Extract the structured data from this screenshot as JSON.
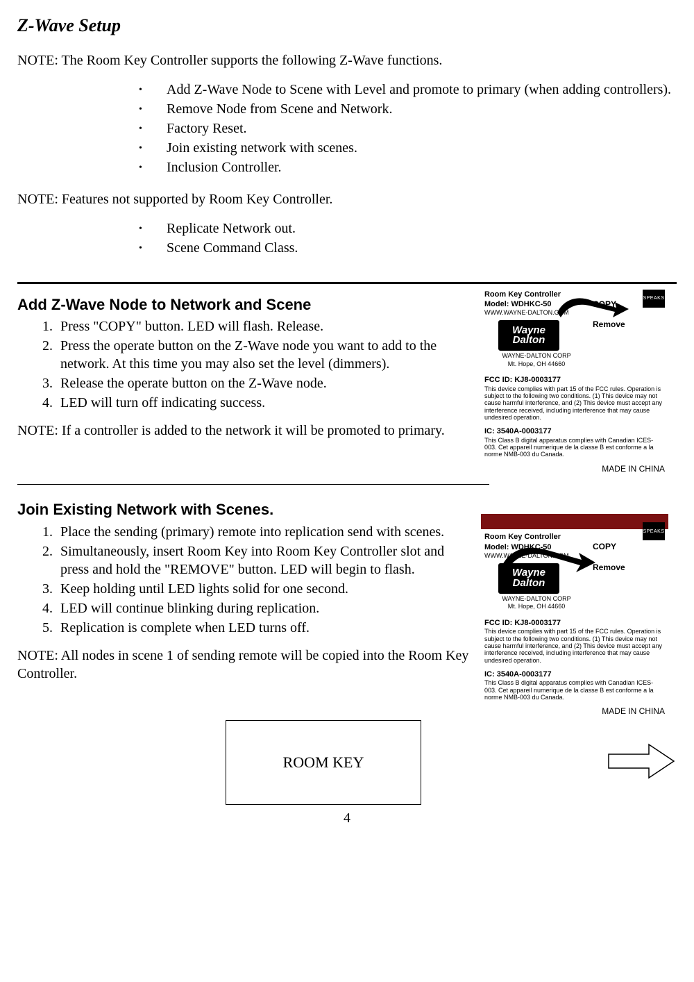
{
  "title": "Z-Wave Setup",
  "note1": "NOTE: The Room Key Controller supports the following Z-Wave functions.",
  "supported": [
    "Add Z-Wave Node to Scene with Level and promote to primary (when adding controllers).",
    "Remove Node from Scene and Network.",
    "Factory Reset.",
    "Join existing network with scenes.",
    "Inclusion Controller."
  ],
  "note2": "NOTE:  Features not supported by Room Key Controller.",
  "unsupported": [
    "Replicate Network out.",
    "Scene Command Class."
  ],
  "section1": {
    "heading": "Add Z-Wave Node to Network and Scene",
    "steps": [
      "Press \"COPY\" button.  LED will flash.  Release.",
      "Press the operate button on the Z-Wave node you want to add to the network.  At this time you may also set the level (dimmers).",
      "Release the operate button on the Z-Wave node.",
      "LED will turn off indicating success."
    ],
    "note": "NOTE: If a controller is added to the network it will be promoted to primary."
  },
  "section2": {
    "heading": "Join Existing Network with Scenes.",
    "steps": [
      "Place the sending (primary) remote into replication send with scenes.",
      "Simultaneously, insert Room Key into Room Key Controller slot and press and hold the \"REMOVE\" button.  LED will begin to flash.",
      "Keep holding until LED lights solid for one second.",
      "LED will continue blinking during replication.",
      "Replication is complete when LED turns off."
    ],
    "note": "NOTE:  All nodes in scene 1 of sending remote will be copied into the Room Key Controller."
  },
  "label": {
    "line1head": "Room Key Controller",
    "line2head": "Model:  WDHKC-50",
    "url": "WWW.WAYNE-DALTON.COM",
    "logo_top": "Wayne",
    "logo_bot": "Dalton",
    "corp": "WAYNE-DALTON CORP",
    "addr": "Mt. Hope, OH 44660",
    "copy_btn": "COPY",
    "remove_btn": "Remove",
    "fcc_hdr": "FCC ID: KJ8-0003177",
    "fcc_body": "This device complies with part 15 of the FCC rules. Operation is subject to the following two conditions. (1) This device may not cause harmful interference, and (2) This device must accept any interference received, including interference that may cause undesired operation.",
    "ic_hdr": "IC: 3540A-0003177",
    "ic_body": "This Class B digital apparatus complies with Canadian ICES-003. Cet appareil numerique de la classe B est conforme a la norme NMB-003 du Canada.",
    "made_in": "MADE IN CHINA",
    "badge": "SPEAKS"
  },
  "roomkey_box": "ROOM KEY",
  "page": "4"
}
